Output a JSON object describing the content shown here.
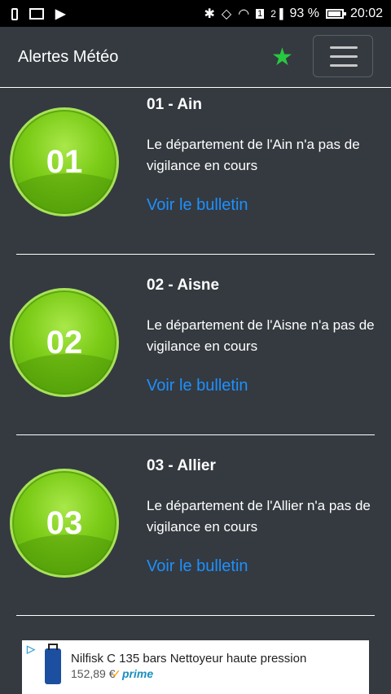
{
  "status_bar": {
    "battery_percent": "93 %",
    "time": "20:02",
    "sim_badge": "1",
    "network": "2"
  },
  "navbar": {
    "brand": "Alertes Météo"
  },
  "departments": [
    {
      "number": "01",
      "title": "01 - Ain",
      "description": "Le département de l'Ain n'a pas de vigilance en cours",
      "link": "Voir le bulletin"
    },
    {
      "number": "02",
      "title": "02 - Aisne",
      "description": "Le département de l'Aisne n'a pas de vigilance en cours",
      "link": "Voir le bulletin"
    },
    {
      "number": "03",
      "title": "03 - Allier",
      "description": "Le département de l'Allier n'a pas de vigilance en cours",
      "link": "Voir le bulletin"
    }
  ],
  "ad": {
    "title": "Nilfisk C 135 bars Nettoyeur haute pression",
    "price": "152,89 €",
    "prime": "prime"
  },
  "colors": {
    "background": "#343a40",
    "accent_star": "#28c840",
    "link": "#1e90ff",
    "badge_green": "#7bcb17"
  }
}
